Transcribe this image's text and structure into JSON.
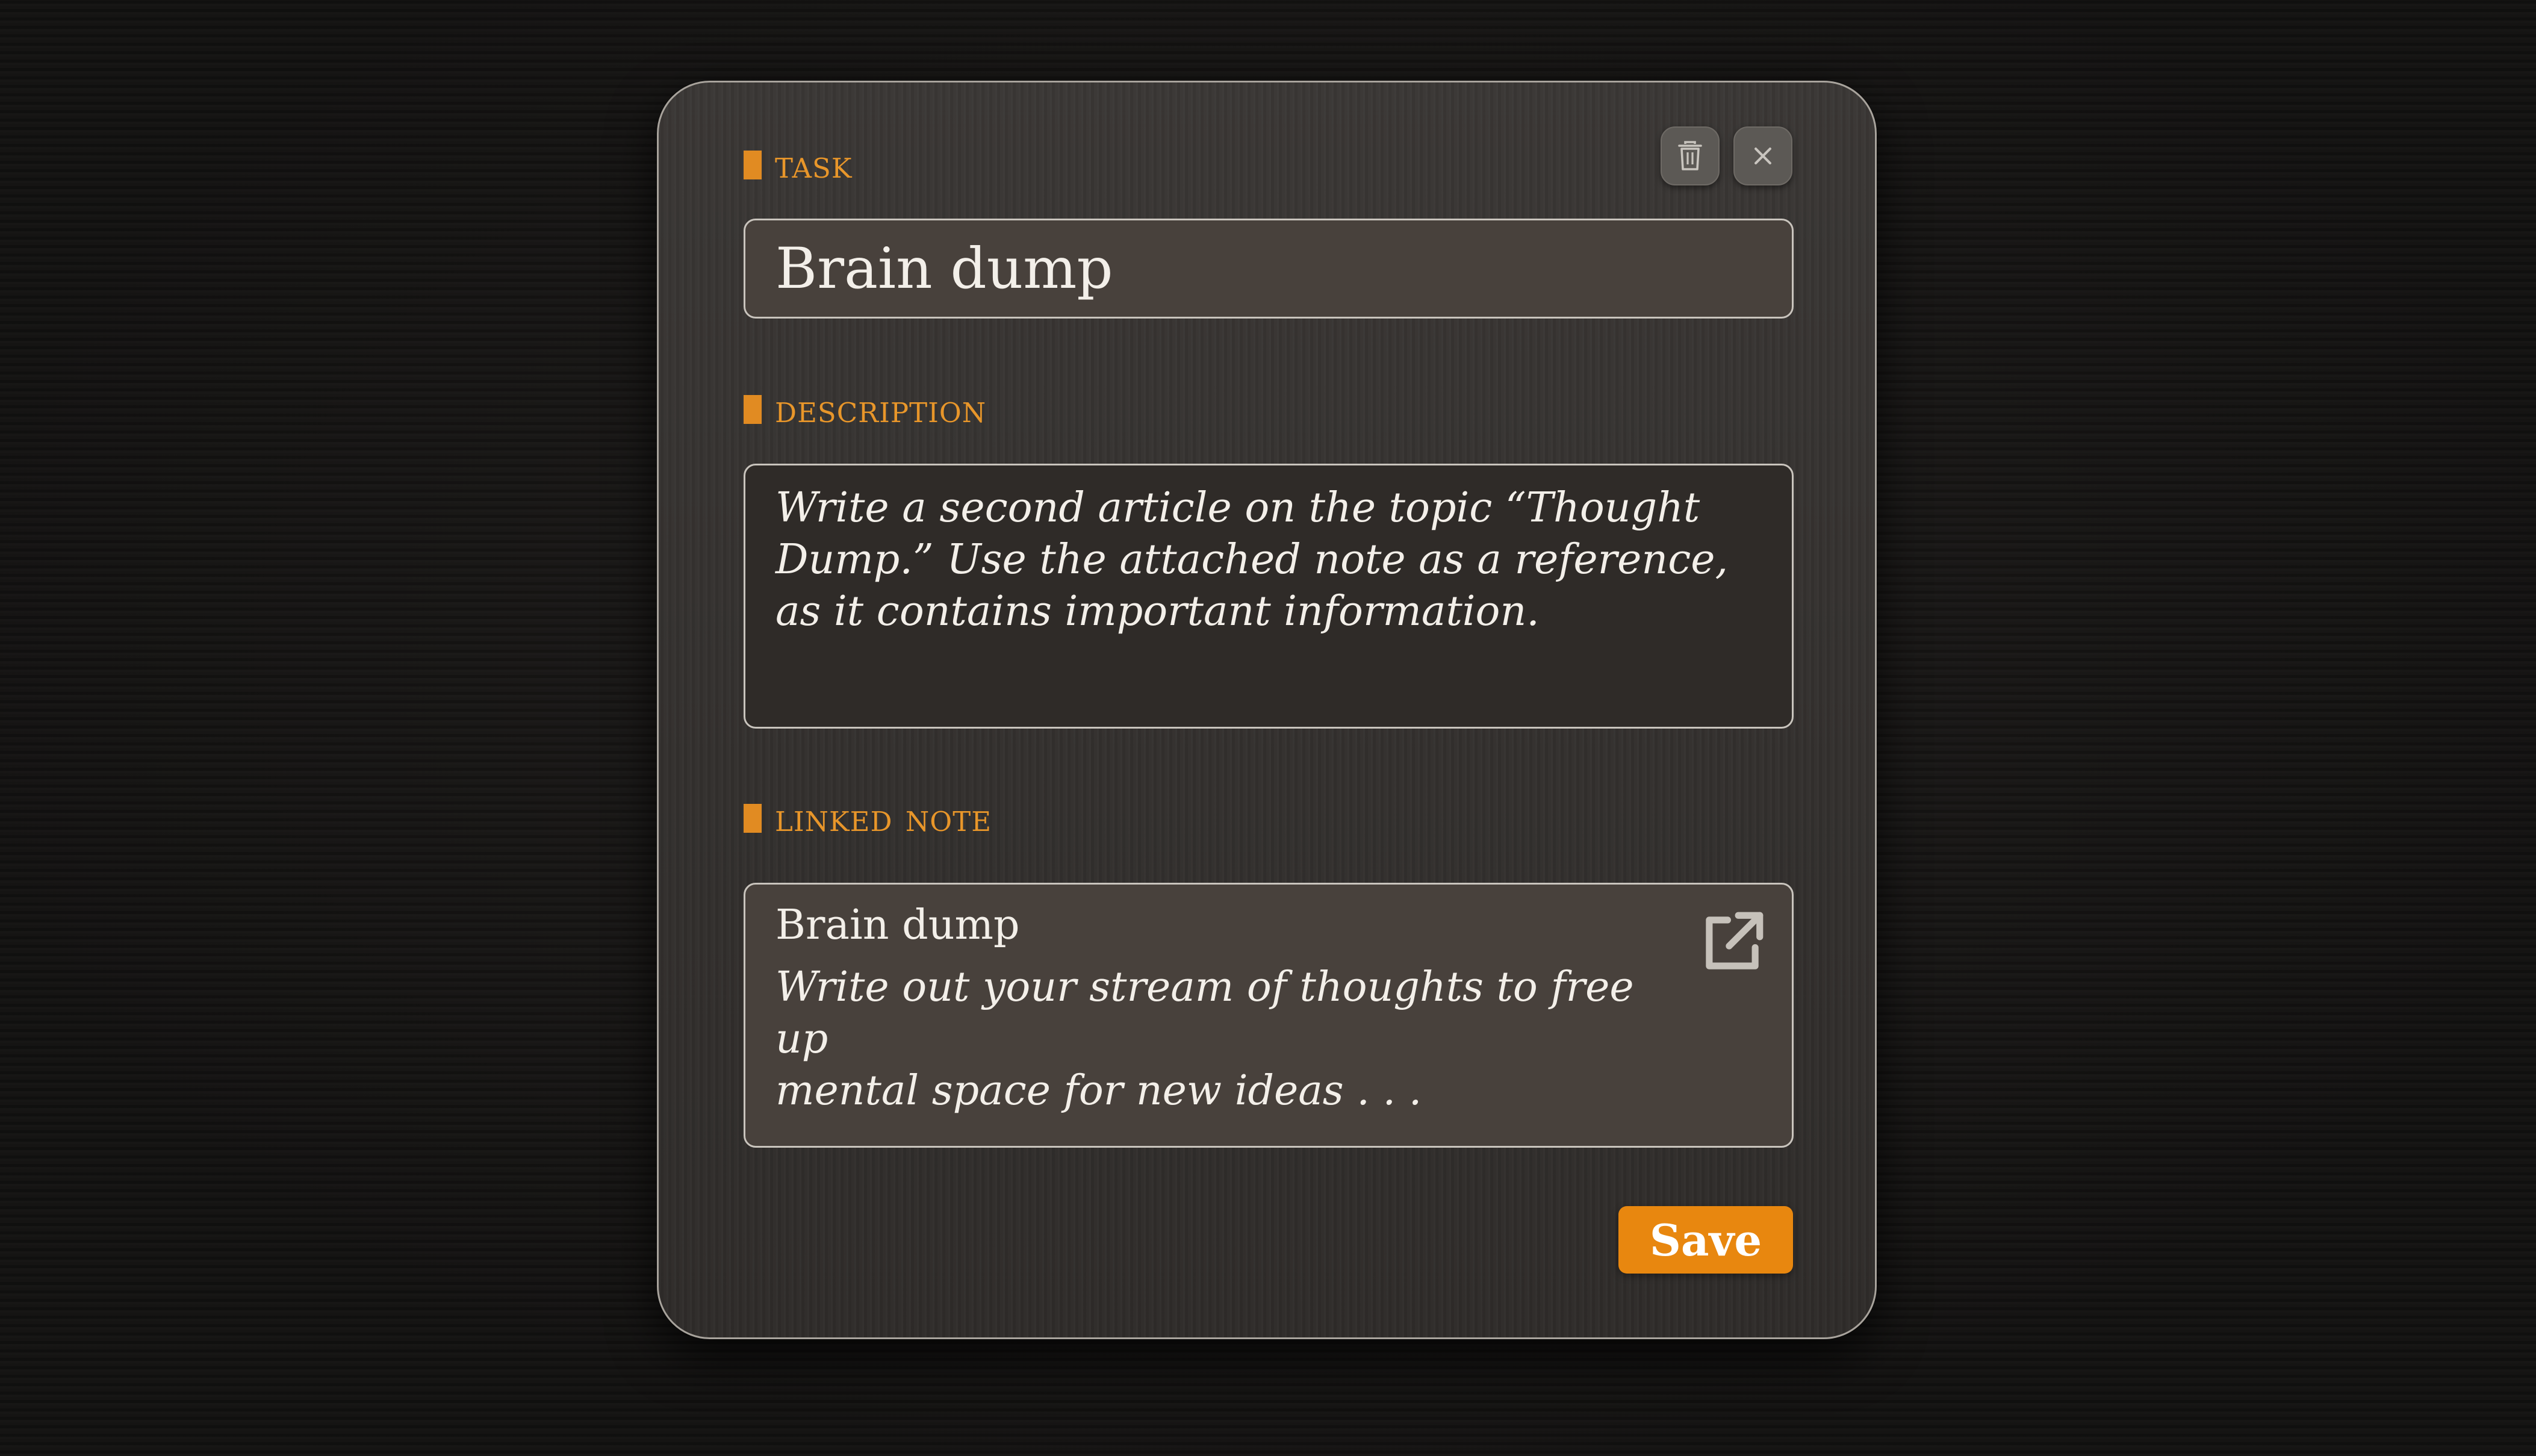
{
  "colors": {
    "accent": "#e8962a",
    "save_button": "#e8870f",
    "panel": "#353230",
    "field_background": "#48413c",
    "description_background": "#2f2b28"
  },
  "header": {
    "delete_icon": "trash-icon",
    "close_icon": "close-icon"
  },
  "task": {
    "label": "TASK",
    "value": "Brain dump"
  },
  "description": {
    "label": "DESCRIPTION",
    "text": "Write a second article on the topic “Thought\nDump.” Use the attached note as a reference,\nas it contains important information."
  },
  "linked_note": {
    "label": "LINKED NOTE",
    "title": "Brain dump",
    "excerpt": "Write out your stream of thoughts to free up\nmental space for new ideas . . .",
    "open_icon": "external-link-icon"
  },
  "footer": {
    "save_label": "Save"
  }
}
